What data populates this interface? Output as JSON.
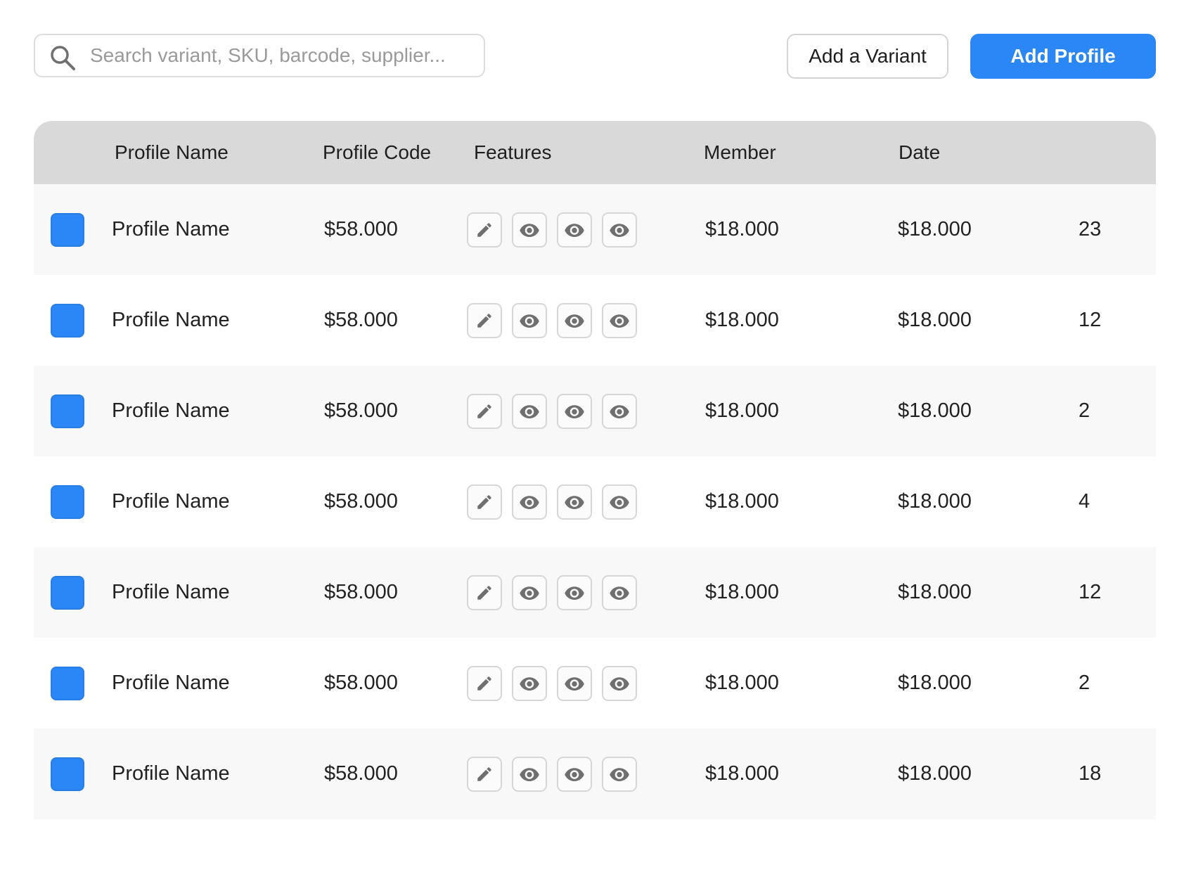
{
  "toolbar": {
    "search_placeholder": "Search variant, SKU, barcode, supplier...",
    "add_variant_label": "Add a Variant",
    "add_profile_label": "Add Profile"
  },
  "colors": {
    "accent": "#2a87f5",
    "header_bg": "#d9d9d9",
    "row_alt_bg": "#f8f8f8"
  },
  "table": {
    "columns": [
      "Profile Name",
      "Profile Code",
      "Features",
      "Member",
      "Date"
    ],
    "action_icons": [
      "pencil-icon",
      "eye-icon",
      "eye-icon",
      "eye-icon"
    ],
    "rows": [
      {
        "name": "Profile Name",
        "code": "$58.000",
        "member": "$18.000",
        "date": "$18.000",
        "count": "23"
      },
      {
        "name": "Profile Name",
        "code": "$58.000",
        "member": "$18.000",
        "date": "$18.000",
        "count": "12"
      },
      {
        "name": "Profile Name",
        "code": "$58.000",
        "member": "$18.000",
        "date": "$18.000",
        "count": "2"
      },
      {
        "name": "Profile Name",
        "code": "$58.000",
        "member": "$18.000",
        "date": "$18.000",
        "count": "4"
      },
      {
        "name": "Profile Name",
        "code": "$58.000",
        "member": "$18.000",
        "date": "$18.000",
        "count": "12"
      },
      {
        "name": "Profile Name",
        "code": "$58.000",
        "member": "$18.000",
        "date": "$18.000",
        "count": "2"
      },
      {
        "name": "Profile Name",
        "code": "$58.000",
        "member": "$18.000",
        "date": "$18.000",
        "count": "18"
      }
    ]
  }
}
